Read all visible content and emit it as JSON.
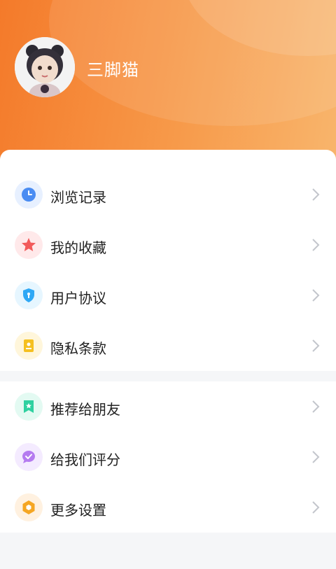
{
  "profile": {
    "username": "三脚猫"
  },
  "menu_group_1": [
    {
      "label": "浏览记录",
      "icon": "clock-icon",
      "color": "#4a8cf2"
    },
    {
      "label": "我的收藏",
      "icon": "star-icon",
      "color": "#f25a5a"
    },
    {
      "label": "用户协议",
      "icon": "shield-icon",
      "color": "#2fa8f5"
    },
    {
      "label": "隐私条款",
      "icon": "document-icon",
      "color": "#f5c020"
    }
  ],
  "menu_group_2": [
    {
      "label": "推荐给朋友",
      "icon": "bookmark-star-icon",
      "color": "#2ed1a0"
    },
    {
      "label": "给我们评分",
      "icon": "chat-check-icon",
      "color": "#b57bf0"
    },
    {
      "label": "更多设置",
      "icon": "hexagon-settings-icon",
      "color": "#f5a623"
    }
  ]
}
